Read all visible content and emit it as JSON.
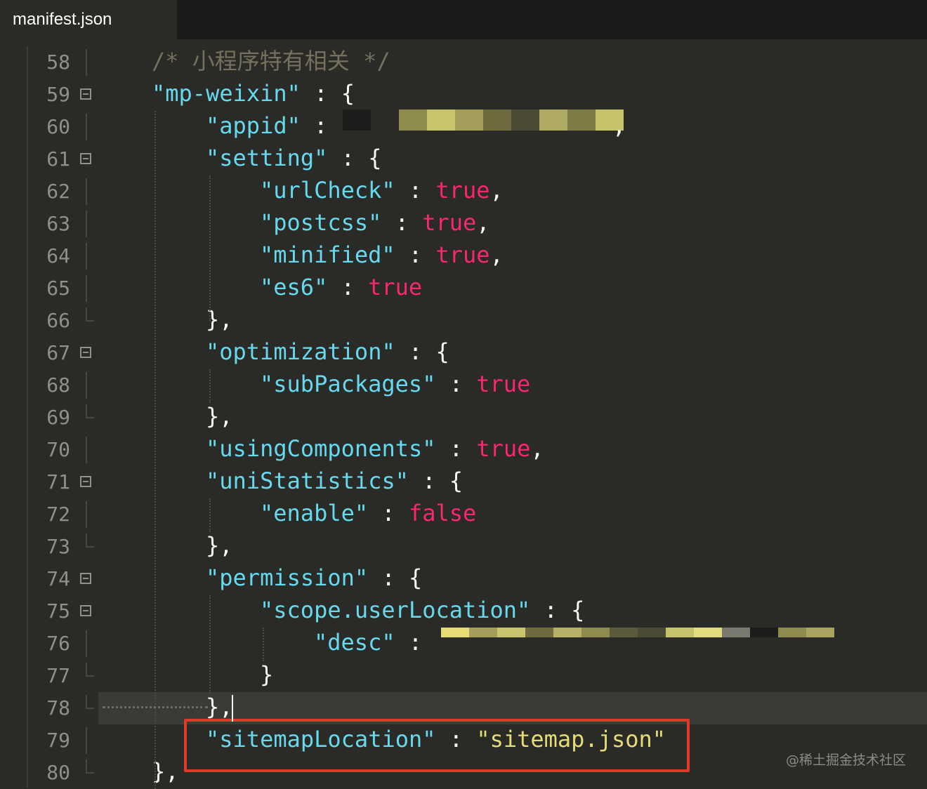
{
  "tab": {
    "title": "manifest.json"
  },
  "lines": [
    {
      "n": "58"
    },
    {
      "n": "59"
    },
    {
      "n": "60"
    },
    {
      "n": "61"
    },
    {
      "n": "62"
    },
    {
      "n": "63"
    },
    {
      "n": "64"
    },
    {
      "n": "65"
    },
    {
      "n": "66"
    },
    {
      "n": "67"
    },
    {
      "n": "68"
    },
    {
      "n": "69"
    },
    {
      "n": "70"
    },
    {
      "n": "71"
    },
    {
      "n": "72"
    },
    {
      "n": "73"
    },
    {
      "n": "74"
    },
    {
      "n": "75"
    },
    {
      "n": "76"
    },
    {
      "n": "77"
    },
    {
      "n": "78"
    },
    {
      "n": "79"
    },
    {
      "n": "80"
    }
  ],
  "code": {
    "l58": "/* 小程序特有相关 */",
    "l59_key": "\"mp-weixin\"",
    "l59_rest": " : {",
    "l60_key": "\"appid\"",
    "l60_rest": " :",
    "l60_tail": ",",
    "l61_key": "\"setting\"",
    "l61_rest": " : {",
    "l62_key": "\"urlCheck\"",
    "l62_val": "true",
    "l63_key": "\"postcss\"",
    "l63_val": "true",
    "l64_key": "\"minified\"",
    "l64_val": "true",
    "l65_key": "\"es6\"",
    "l65_val": "true",
    "l66": "},",
    "l67_key": "\"optimization\"",
    "l67_rest": " : {",
    "l68_key": "\"subPackages\"",
    "l68_val": "true",
    "l69": "},",
    "l70_key": "\"usingComponents\"",
    "l70_val": "true",
    "l71_key": "\"uniStatistics\"",
    "l71_rest": " : {",
    "l72_key": "\"enable\"",
    "l72_val": "false",
    "l73": "},",
    "l74_key": "\"permission\"",
    "l74_rest": " : {",
    "l75_key": "\"scope.userLocation\"",
    "l75_rest": " : {",
    "l76_key": "\"desc\"",
    "l76_rest": " :",
    "l77": "}",
    "l78": "},",
    "l79_key": "\"sitemapLocation\"",
    "l79_rest": " : ",
    "l79_val": "\"sitemap.json\"",
    "l80": "},"
  },
  "colors": {
    "key": "#66d9ef",
    "keyword": "#f92672",
    "string": "#e6db74",
    "comment": "#75715e",
    "highlight_box": "#e0392b"
  },
  "watermark": "@稀土掘金技术社区"
}
